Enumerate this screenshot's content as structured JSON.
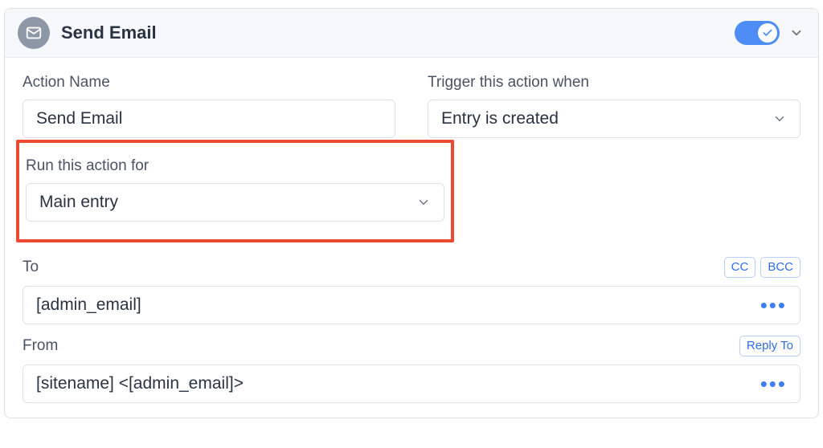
{
  "header": {
    "title": "Send Email",
    "enabled": true
  },
  "fields": {
    "action_name": {
      "label": "Action Name",
      "value": "Send Email"
    },
    "trigger": {
      "label": "Trigger this action when",
      "value": "Entry is created"
    },
    "run_for": {
      "label": "Run this action for",
      "value": "Main entry"
    },
    "to": {
      "label": "To",
      "value": "[admin_email]",
      "cc_label": "CC",
      "bcc_label": "BCC"
    },
    "from": {
      "label": "From",
      "value": "[sitename] <[admin_email]>",
      "reply_to_label": "Reply To"
    }
  }
}
